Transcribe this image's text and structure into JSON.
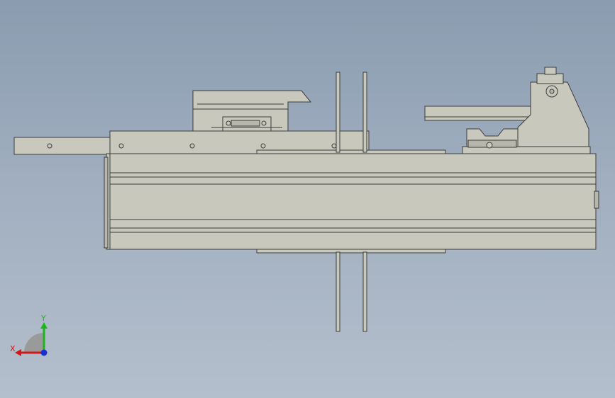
{
  "viewport": {
    "background_top": "#8a9cb0",
    "background_bottom": "#b4bfcc"
  },
  "model": {
    "part_fill": "#c9c8bd",
    "part_fill_dark": "#b7b6aa",
    "outline": "#3c3c3c"
  },
  "triad": {
    "x_label": "X",
    "y_label": "Y",
    "x_color": "#d01818",
    "y_color": "#18b818",
    "z_color": "#1830d0"
  }
}
